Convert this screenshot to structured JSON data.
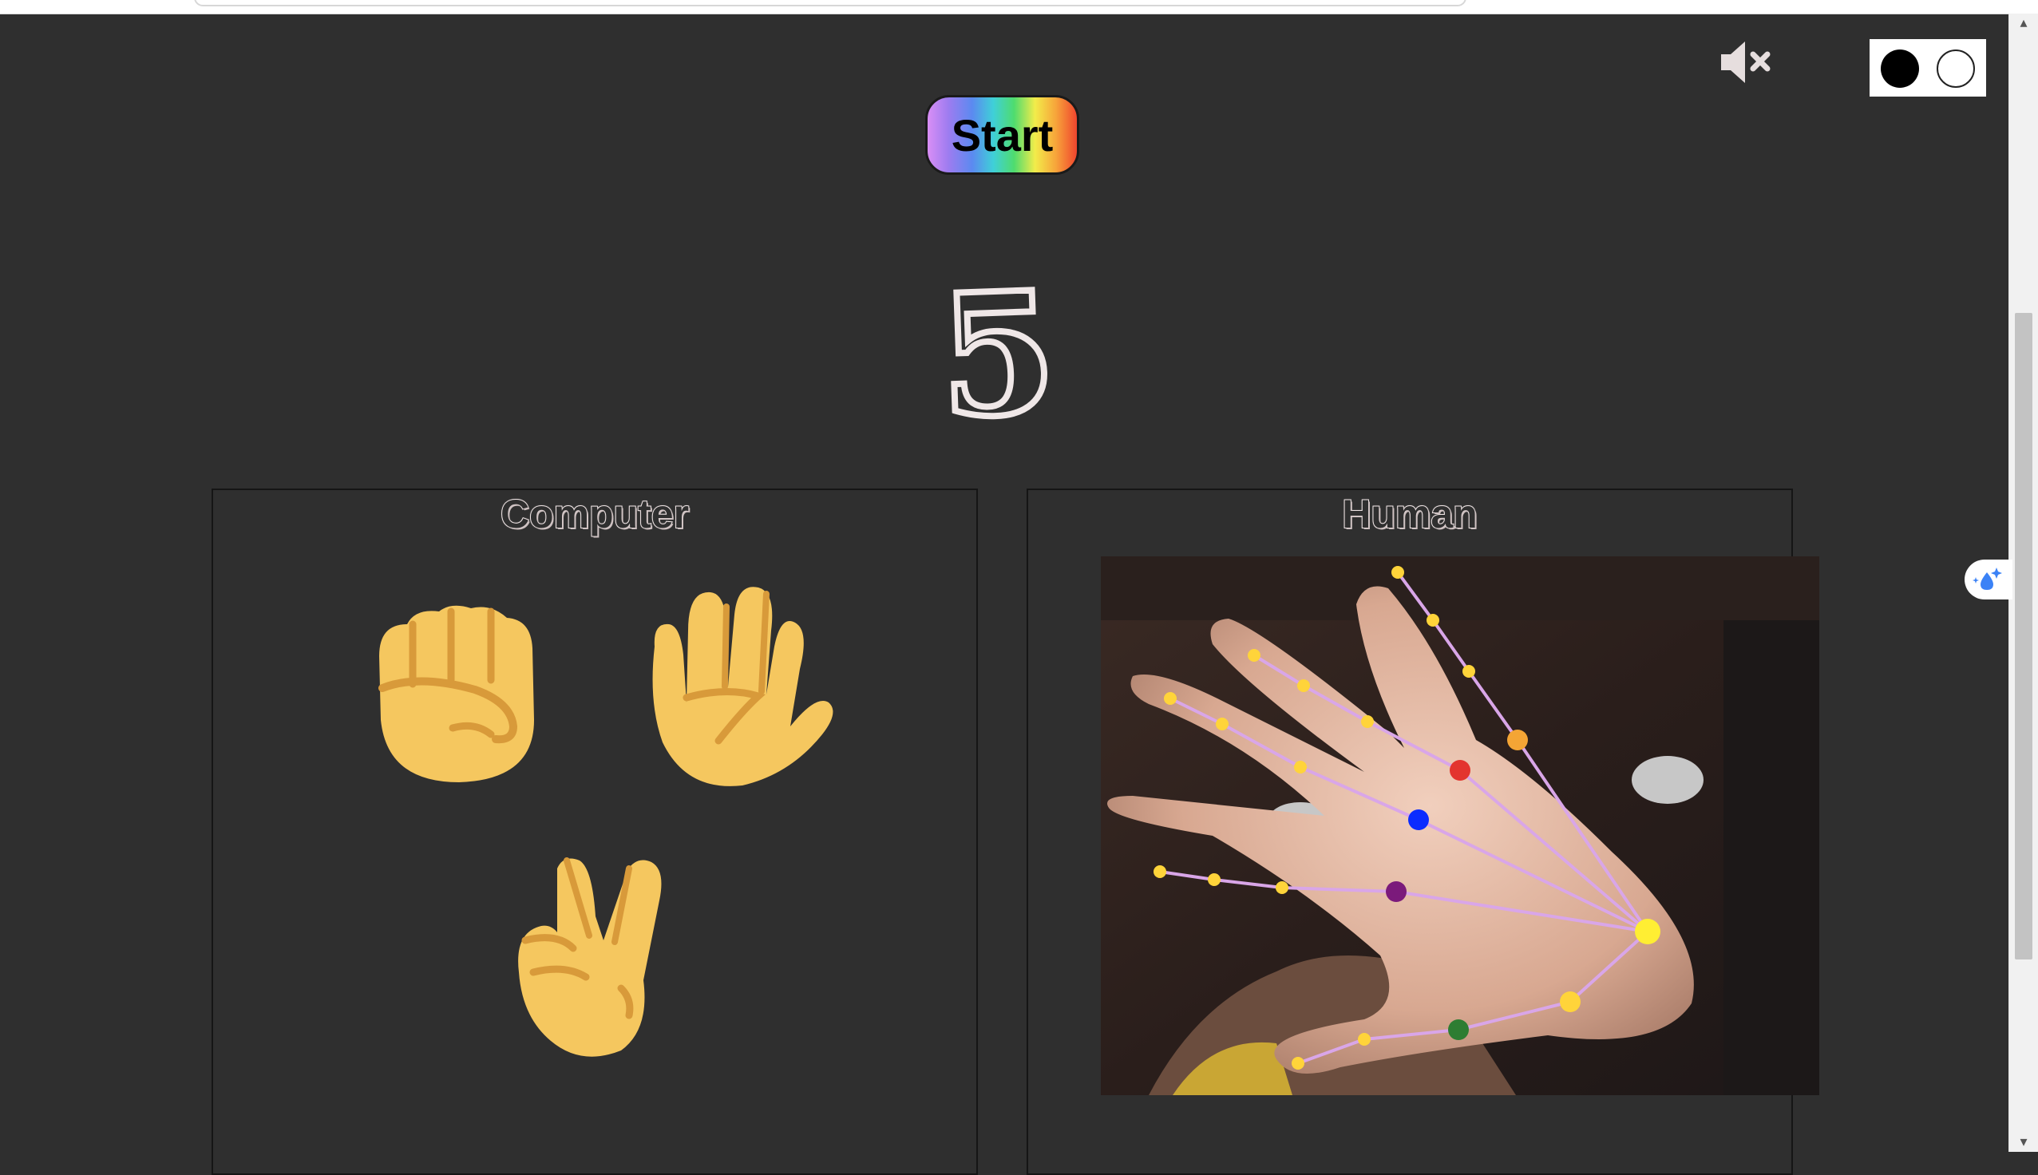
{
  "controls": {
    "start_label": "Start",
    "mute_icon": "speaker-muted-icon",
    "theme_options": [
      "black",
      "white"
    ]
  },
  "countdown": {
    "value": "5"
  },
  "panels": {
    "computer": {
      "title": "Computer",
      "choices": [
        {
          "name": "rock",
          "icon": "raised-fist-icon"
        },
        {
          "name": "paper",
          "icon": "raised-hand-icon"
        },
        {
          "name": "scissors",
          "icon": "victory-hand-icon"
        }
      ]
    },
    "human": {
      "title": "Human",
      "camera": "webcam feed with hand landmark overlay"
    }
  },
  "colors": {
    "background": "#2f2f2f",
    "emoji_skin": "#f5c75f",
    "emoji_shade": "#d89a3a",
    "landmark_line": "#d9a6e8",
    "landmark_point": "#ffd43a"
  }
}
